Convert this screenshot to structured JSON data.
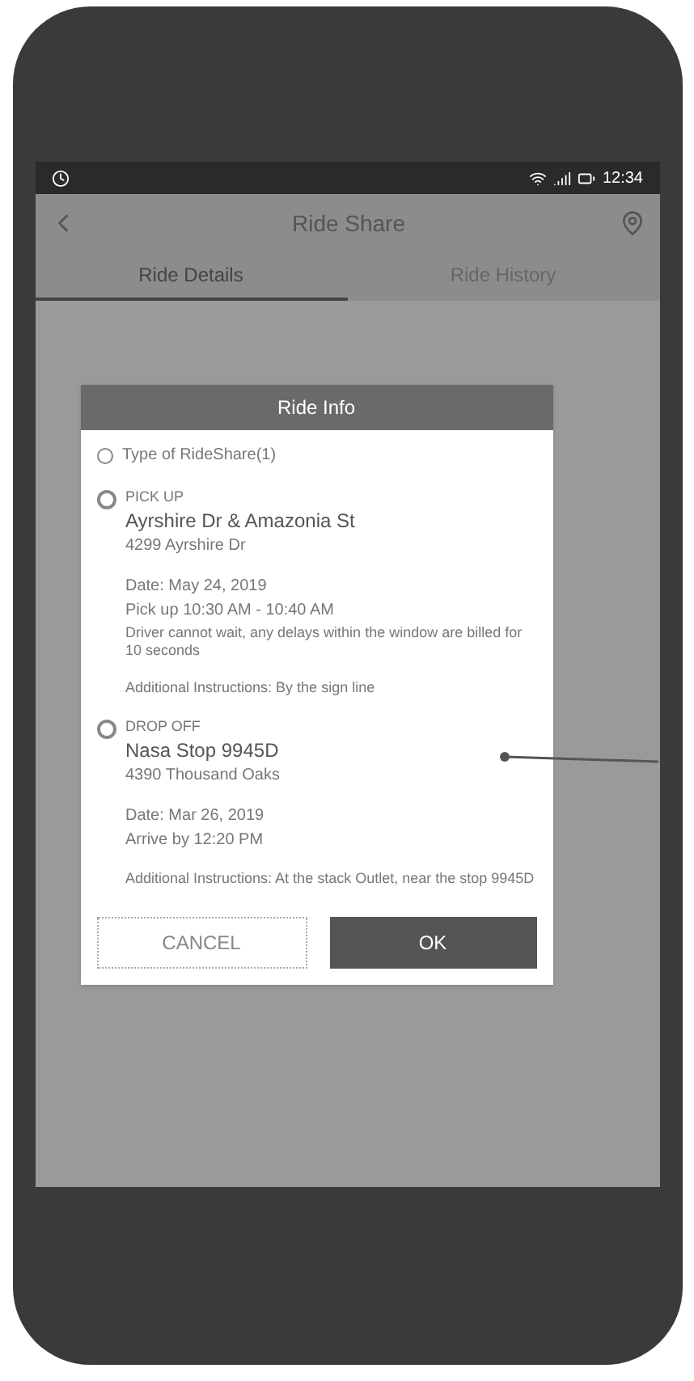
{
  "status_bar": {
    "time": "12:34"
  },
  "app_bar": {
    "title": "Ride Share"
  },
  "tabs": [
    {
      "label": "Ride Details",
      "selected": true
    },
    {
      "label": "Ride History",
      "selected": false
    }
  ],
  "dialog": {
    "title": "Ride Info",
    "subtitle": "Type of RideShare(1)",
    "stops": [
      {
        "label": "PICK UP",
        "name": "Ayrshire Dr & Amazonia St",
        "address": "4299 Ayrshire Dr",
        "date": "Date: May 24, 2019",
        "time": "Pick up 10:30 AM - 10:40 AM",
        "note": "Driver cannot wait, any delays within the window are billed for 10 seconds",
        "instructions": "Additional Instructions: By the sign line"
      },
      {
        "label": "DROP OFF",
        "name": "Nasa Stop 9945D",
        "address": "4390 Thousand Oaks",
        "date": "Date: Mar 26, 2019",
        "time": "Arrive by 12:20 PM",
        "instructions": "Additional Instructions: At the stack Outlet, near the stop 9945D"
      }
    ],
    "buttons": [
      {
        "label": "CANCEL",
        "kind": "secondary"
      },
      {
        "label": "OK",
        "kind": "primary"
      }
    ]
  }
}
